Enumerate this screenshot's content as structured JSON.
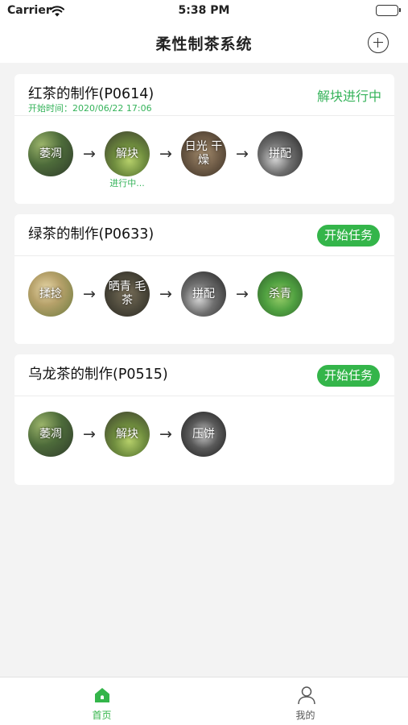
{
  "status_bar": {
    "carrier": "Carrier",
    "time": "5:38 PM",
    "icons": [
      "wifi-icon",
      "battery-icon"
    ]
  },
  "nav": {
    "title": "柔性制茶系统",
    "action_icon": "add-circle-icon"
  },
  "cards": [
    {
      "title": "红茶的制作(P0614)",
      "subtitle": "开始时间：2020/06/22 17:06",
      "status": "解块进行中",
      "steps": [
        {
          "label": "萎凋"
        },
        {
          "label": "解块",
          "progress": "进行中..."
        },
        {
          "label": "日光 干燥"
        },
        {
          "label": "拼配"
        }
      ]
    },
    {
      "title": "绿茶的制作(P0633)",
      "button": "开始任务",
      "steps": [
        {
          "label": "揉捻"
        },
        {
          "label": "晒青 毛茶"
        },
        {
          "label": "拼配"
        },
        {
          "label": "杀青"
        }
      ]
    },
    {
      "title": "乌龙茶的制作(P0515)",
      "button": "开始任务",
      "steps": [
        {
          "label": "萎凋"
        },
        {
          "label": "解块"
        },
        {
          "label": "压饼"
        }
      ]
    }
  ],
  "arrow": "→",
  "tabs": [
    {
      "label": "首页",
      "icon": "home-icon",
      "active": true
    },
    {
      "label": "我的",
      "icon": "person-icon",
      "active": false
    }
  ],
  "colors": {
    "accent": "#35b35a",
    "button": "#34b54a",
    "background": "#f3f3f3"
  }
}
